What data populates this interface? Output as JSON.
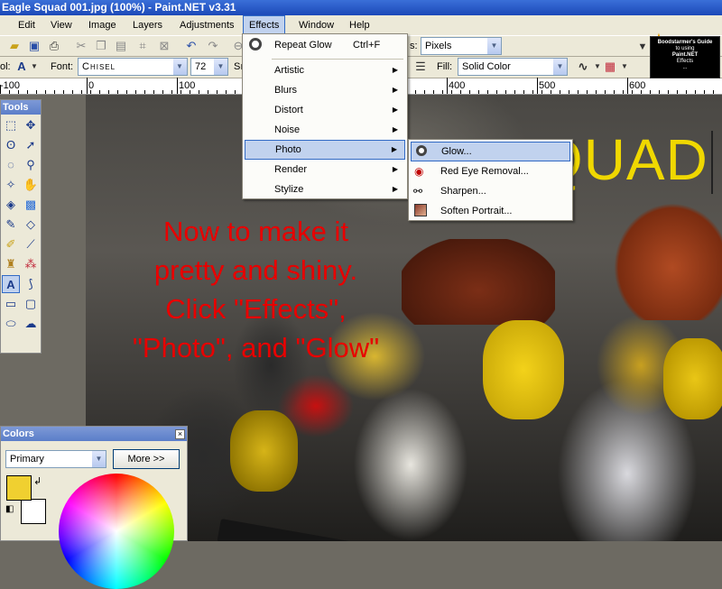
{
  "window": {
    "title": "Eagle Squad 001.jpg (100%) - Paint.NET v3.31"
  },
  "menu": [
    "Edit",
    "View",
    "Image",
    "Layers",
    "Adjustments",
    "Effects",
    "Window",
    "Help"
  ],
  "toolbar": {
    "units_label": "s:",
    "units_value": "Pixels",
    "font_label": "Font:",
    "font_value": "Chisel",
    "font_size": "72",
    "tool_label": "ol:",
    "fill_label": "Fill:",
    "fill_value": "Solid Color",
    "partial_label": "Sı"
  },
  "ruler": {
    "labels": [
      "-100",
      "0",
      "100",
      "400",
      "500",
      "600"
    ]
  },
  "canvas": {
    "title_text": "EAGLE SQUAD",
    "instruction_lines": [
      "Now to make it",
      "pretty and shiny.",
      "Click \"Effects\",",
      "\"Photo\", and \"Glow\""
    ]
  },
  "thumbnail": {
    "lines": [
      "Boodstarmer's Guide",
      "to using",
      "Paint.NET",
      "Effects",
      "..."
    ]
  },
  "tools_panel": {
    "title": "Tools"
  },
  "colors_panel": {
    "title": "Colors",
    "mode_value": "Primary",
    "more_label": "More >>",
    "primary_color": "#f0d030"
  },
  "effects_menu": {
    "repeat_label": "Repeat Glow",
    "repeat_shortcut": "Ctrl+F",
    "items": [
      "Artistic",
      "Blurs",
      "Distort",
      "Noise",
      "Photo",
      "Render",
      "Stylize"
    ]
  },
  "photo_submenu": {
    "items": [
      "Glow...",
      "Red Eye Removal...",
      "Sharpen...",
      "Soften Portrait..."
    ]
  }
}
